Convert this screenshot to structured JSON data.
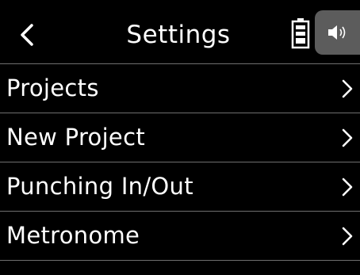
{
  "header": {
    "title": "Settings",
    "back_icon": "chevron-left-icon",
    "battery_icon": "battery-icon",
    "speaker_icon": "speaker-icon"
  },
  "menu": {
    "items": [
      {
        "label": "Projects"
      },
      {
        "label": "New Project"
      },
      {
        "label": "Punching In/Out"
      },
      {
        "label": "Metronome"
      }
    ]
  }
}
